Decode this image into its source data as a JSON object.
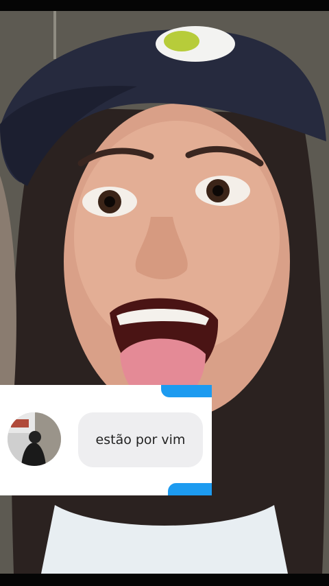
{
  "story": {
    "background_image": "selfie-photo",
    "reply_card": {
      "avatar": "user-avatar-photo",
      "message": "estão por vim",
      "accent_color": "#1d9bf0"
    }
  }
}
